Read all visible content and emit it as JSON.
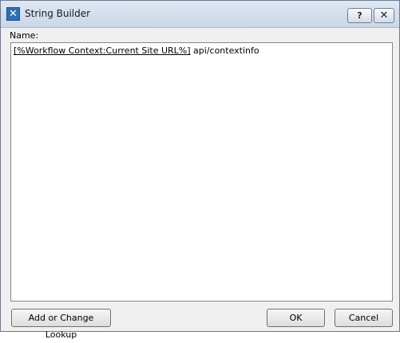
{
  "window": {
    "title": "String Builder",
    "help_label": "?",
    "close_label": "✕"
  },
  "form": {
    "name_label": "Name:",
    "lookup_token": "[%Workflow Context:Current Site URL%]",
    "literal_text": " api/contextinfo"
  },
  "buttons": {
    "lookup_label": "Add or Change Lookup",
    "ok_label": "OK",
    "cancel_label": "Cancel"
  },
  "icons": {
    "app": "string-builder-app-icon"
  }
}
